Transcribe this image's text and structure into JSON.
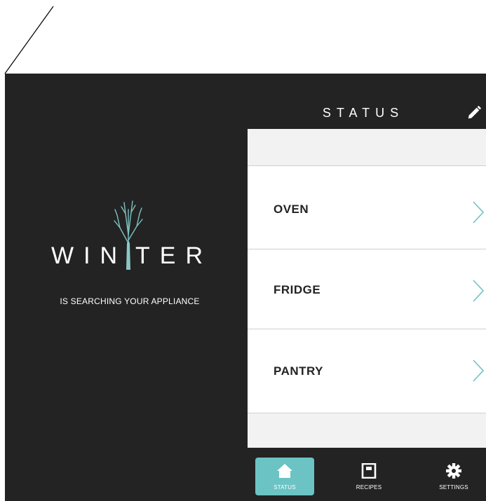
{
  "splash": {
    "logo_left": "WIN",
    "logo_right": "TER",
    "logo_text": "WINTER",
    "subtitle": "IS SEARCHING YOUR APPLIANCE"
  },
  "header": {
    "title": "STATUS",
    "edit_icon": "pencil-icon"
  },
  "list": {
    "items": [
      {
        "label": "OVEN",
        "icon": "chevron-right-icon"
      },
      {
        "label": "FRIDGE",
        "icon": "chevron-right-icon"
      },
      {
        "label": "PANTRY",
        "icon": "chevron-right-icon"
      }
    ]
  },
  "tabbar": {
    "tabs": [
      {
        "label": "STATUS",
        "icon": "home-icon",
        "active": true
      },
      {
        "label": "RECIPES",
        "icon": "book-icon",
        "active": false
      },
      {
        "label": "SETTINGS",
        "icon": "gear-icon",
        "active": false
      }
    ]
  },
  "colors": {
    "background_dark": "#232323",
    "accent": "#6cc3c4",
    "list_bg": "#f2f2f2",
    "row_bg": "#ffffff"
  }
}
